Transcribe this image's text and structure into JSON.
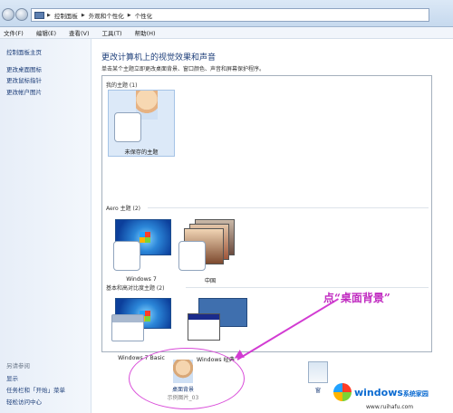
{
  "address": {
    "crumbs": [
      "控制面板",
      "外观和个性化",
      "个性化"
    ]
  },
  "menu": [
    "文件(F)",
    "编辑(E)",
    "查看(V)",
    "工具(T)",
    "帮助(H)"
  ],
  "left_pane": {
    "links": [
      "控制面板主页",
      "更改桌面图标",
      "更改鼠标指针",
      "更改帐户图片"
    ],
    "see_also_header": "另请参阅",
    "see_also": [
      "显示",
      "任务栏和「开始」菜单",
      "轻松访问中心"
    ]
  },
  "main": {
    "title": "更改计算机上的视觉效果和声音",
    "subtitle": "单击某个主题立即更改桌面背景、窗口颜色、声音和屏幕保护程序。",
    "groups": {
      "my": "我的主题 (1)",
      "aero": "Aero 主题 (2)",
      "basic": "基本和高对比度主题 (2)"
    },
    "themes": {
      "unsaved": "未保存的主题",
      "win7": "Windows 7",
      "china": "中国",
      "win7basic": "Windows 7 Basic",
      "classic": "Windows 经典"
    },
    "bottom": {
      "desktop_bg": "桌面背景",
      "desktop_bg_sub": "示例图片_03",
      "window_color_partial": "窗"
    }
  },
  "annotation": {
    "callout": "点“桌面背景”"
  },
  "watermark": {
    "brand": "windows",
    "brand_cn": "系统家园",
    "url": "www.ruihafu.com"
  }
}
